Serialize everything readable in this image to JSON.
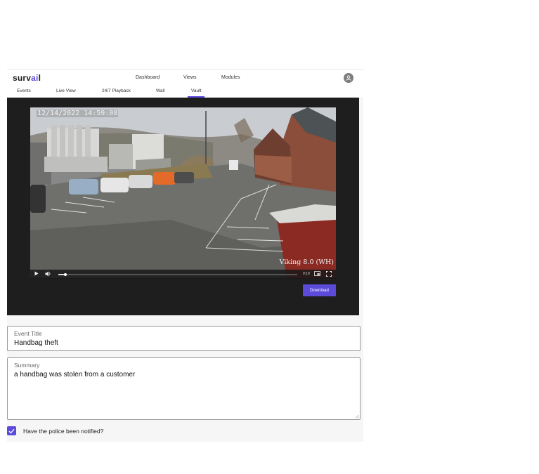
{
  "app": {
    "logo_text_prefix": "surv",
    "logo_text_accent": "ai",
    "logo_text_suffix": "l",
    "accent_color": "#5b4bdb"
  },
  "top_nav": {
    "items": [
      {
        "label": "Dashboard"
      },
      {
        "label": "Views"
      },
      {
        "label": "Modules"
      }
    ]
  },
  "sub_nav": {
    "items": [
      {
        "label": "Events"
      },
      {
        "label": "Live View"
      },
      {
        "label": "24/7 Playback"
      },
      {
        "label": "Wall"
      },
      {
        "label": "Vault"
      }
    ],
    "active": "Vault"
  },
  "video": {
    "timestamp": "12/14/2022 14:59:08",
    "camera_name": "Viking 8.0 (WH)",
    "current_time": "0:19",
    "progress": 0.03
  },
  "download_label": "Download",
  "form": {
    "event_title_label": "Event Title",
    "event_title_value": "Handbag theft",
    "summary_label": "Summary",
    "summary_value": "a handbag was stolen from a customer",
    "police_label": "Have the police been notified?",
    "police_checked": true
  },
  "icons": [
    "user-avatar-icon",
    "play-icon",
    "volume-icon",
    "picture-in-picture-icon",
    "fullscreen-icon",
    "checkmark-icon"
  ]
}
